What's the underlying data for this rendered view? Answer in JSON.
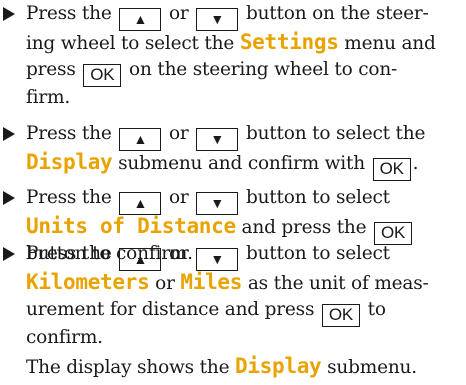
{
  "keys": {
    "up": "▲",
    "down": "▼",
    "ok": "OK"
  },
  "highlight_color": "#e8a300",
  "steps": [
    {
      "l1": {
        "a": "Press the",
        "b": "or",
        "c": "button on the steer-"
      },
      "l2": {
        "a": "ing wheel to select the",
        "kw": "Settings",
        "b": "menu and"
      },
      "l3": {
        "a": "press",
        "b": "on the steering wheel to con-"
      },
      "l4": {
        "a": "firm."
      }
    },
    {
      "l1": {
        "a": "Press the",
        "b": "or",
        "c": "button to select the"
      },
      "l2": {
        "kw": "Display",
        "a": "submenu and confirm with",
        "b": "."
      }
    },
    {
      "l1": {
        "a": "Press the",
        "b": "or",
        "c": "button to select"
      },
      "l2": {
        "kw": "Units of Distance",
        "a": "and press the"
      },
      "l3": {
        "a": "button to confirm."
      }
    },
    {
      "l1": {
        "a": "Press the",
        "b": "or",
        "c": "button to select"
      },
      "l2": {
        "kw1": "Kilometers",
        "a": "or",
        "kw2": "Miles",
        "b": "as the unit of meas-"
      },
      "l3": {
        "a": "urement for distance and press",
        "b": "to"
      },
      "l4": {
        "a": "confirm."
      },
      "l5": {
        "a": "The display shows the",
        "kw": "Display",
        "b": "submenu."
      }
    }
  ]
}
